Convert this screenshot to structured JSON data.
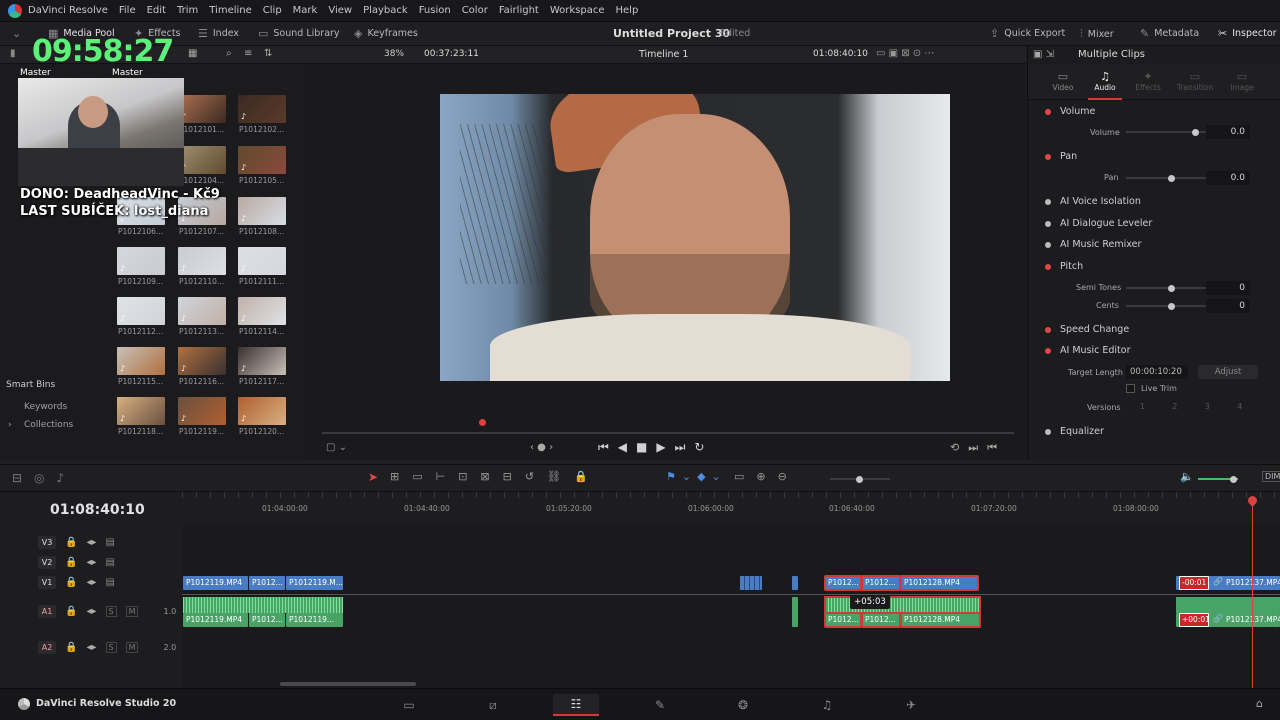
{
  "menu": [
    "DaVinci Resolve",
    "File",
    "Edit",
    "Trim",
    "Timeline",
    "Clip",
    "Mark",
    "View",
    "Playback",
    "Fusion",
    "Color",
    "Fairlight",
    "Workspace",
    "Help"
  ],
  "toolbar": {
    "media_pool": "Media Pool",
    "effects": "Effects",
    "index": "Index",
    "sound_library": "Sound Library",
    "keyframes": "Keyframes",
    "project_title": "Untitled Project 30",
    "edited": "Edited",
    "quick_export": "Quick Export",
    "mixer": "Mixer",
    "metadata": "Metadata",
    "inspector": "Inspector"
  },
  "overlay": {
    "clock": "09:58:27",
    "dono": "DONO: DeadheadVinc - Kč9",
    "sub": "LAST SUBÍČEK: lost_diana",
    "master1": "Master",
    "master2": "Master"
  },
  "pool": {
    "clips": [
      [
        "P1012101...",
        "P1012102..."
      ],
      [
        "P1012104...",
        "P1012105..."
      ],
      [
        "P1012106...",
        "P1012107...",
        "P1012108..."
      ],
      [
        "P1012109...",
        "P1012110...",
        "P1012111..."
      ],
      [
        "P1012112...",
        "P1012113...",
        "P1012114..."
      ],
      [
        "P1012115...",
        "P1012116...",
        "P1012117..."
      ],
      [
        "P1012118...",
        "P1012119...",
        "P1012120..."
      ]
    ],
    "smart_bins": "Smart Bins",
    "keywords": "Keywords",
    "collections": "Collections"
  },
  "viewer": {
    "zoom": "38%",
    "source_tc": "00:37:23:11",
    "timeline": "Timeline 1",
    "record_tc": "01:08:40:10"
  },
  "inspector": {
    "header": "Multiple Clips",
    "tabs": [
      "Video",
      "Audio",
      "Effects",
      "Transition",
      "Image"
    ],
    "volume": "Volume",
    "volume_sub": "Volume",
    "volume_val": "0.0",
    "pan": "Pan",
    "pan_sub": "Pan",
    "pan_val": "0.0",
    "voice_iso": "AI Voice Isolation",
    "dialogue": "AI Dialogue Leveler",
    "remixer": "AI Music Remixer",
    "pitch": "Pitch",
    "semi": "Semi Tones",
    "semi_val": "0",
    "cents": "Cents",
    "cents_val": "0",
    "speed": "Speed Change",
    "music_editor": "AI Music Editor",
    "target": "Target Length",
    "target_val": "00:00:10:20",
    "adjust": "Adjust",
    "live_trim": "Live Trim",
    "versions": "Versions",
    "version_nums": [
      "1",
      "2",
      "3",
      "4"
    ],
    "equalizer": "Equalizer"
  },
  "timeline": {
    "tc": "01:08:40:10",
    "ruler": [
      "01:04:00:00",
      "01:04:40:00",
      "01:05:20:00",
      "01:06:00:00",
      "01:06:40:00",
      "01:07:20:00",
      "01:08:00:00"
    ],
    "tracks": {
      "v3": "V3",
      "v2": "V2",
      "v1": "V1",
      "a1": "A1",
      "a2": "A2",
      "a1_level": "1.0",
      "a2_level": "2.0",
      "s": "S",
      "m": "M"
    },
    "clips": {
      "v1a": "P1012119.MP4",
      "v1b": "P1012...",
      "v1c": "P1012119.M...",
      "v1d": "P1012...",
      "v1e": "P1012...",
      "v1f": "P1012128.MP4",
      "v1g": "P1012137.MP4",
      "a1a": "P1012119.MP4",
      "a1b": "P1012...",
      "a1c": "P1012119...",
      "a1d": "P1012...",
      "a1e": "P1012...",
      "a1f": "P1012128.MP4",
      "a1g": "P1012137.MP4",
      "drag": "+05:03",
      "off1": "-00:01",
      "off2": "+00:01"
    },
    "dim": "DIM"
  },
  "bottom": {
    "app": "DaVinci Resolve Studio 20"
  }
}
